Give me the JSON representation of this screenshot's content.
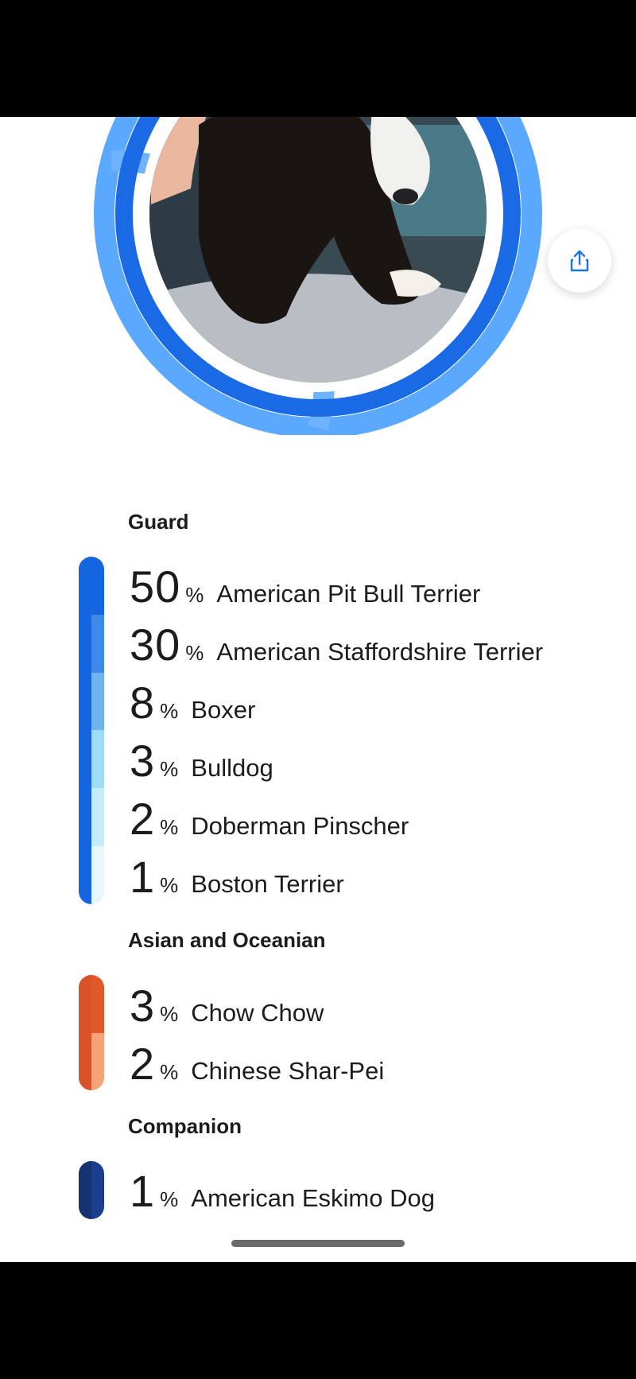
{
  "ring_colors": [
    "#1a73e8",
    "#5aa8ff",
    "#9fd0ff"
  ],
  "share": {
    "icon": "share-icon"
  },
  "groups": [
    {
      "title": "Guard",
      "breeds": [
        {
          "pct": "50",
          "sign": "%",
          "name": "American Pit Bull Terrier",
          "color": "#1565e0"
        },
        {
          "pct": "30",
          "sign": "%",
          "name": "American Staffordshire Terrier",
          "color": "#3f8ae8"
        },
        {
          "pct": "8",
          "sign": "%",
          "name": "Boxer",
          "color": "#6fb3f0"
        },
        {
          "pct": "3",
          "sign": "%",
          "name": "Bulldog",
          "color": "#9fdcf6"
        },
        {
          "pct": "2",
          "sign": "%",
          "name": "Doberman Pinscher",
          "color": "#c6ecfb"
        },
        {
          "pct": "1",
          "sign": "%",
          "name": "Boston Terrier",
          "color": "#e6f7fe"
        }
      ]
    },
    {
      "title": "Asian and Oceanian",
      "breeds": [
        {
          "pct": "3",
          "sign": "%",
          "name": "Chow Chow",
          "color": "#e0582a"
        },
        {
          "pct": "2",
          "sign": "%",
          "name": "Chinese Shar-Pei",
          "color": "#f7a277"
        }
      ]
    },
    {
      "title": "Companion",
      "breeds": [
        {
          "pct": "1",
          "sign": "%",
          "name": "American Eskimo Dog",
          "color": "#1a3f8f"
        }
      ]
    }
  ]
}
